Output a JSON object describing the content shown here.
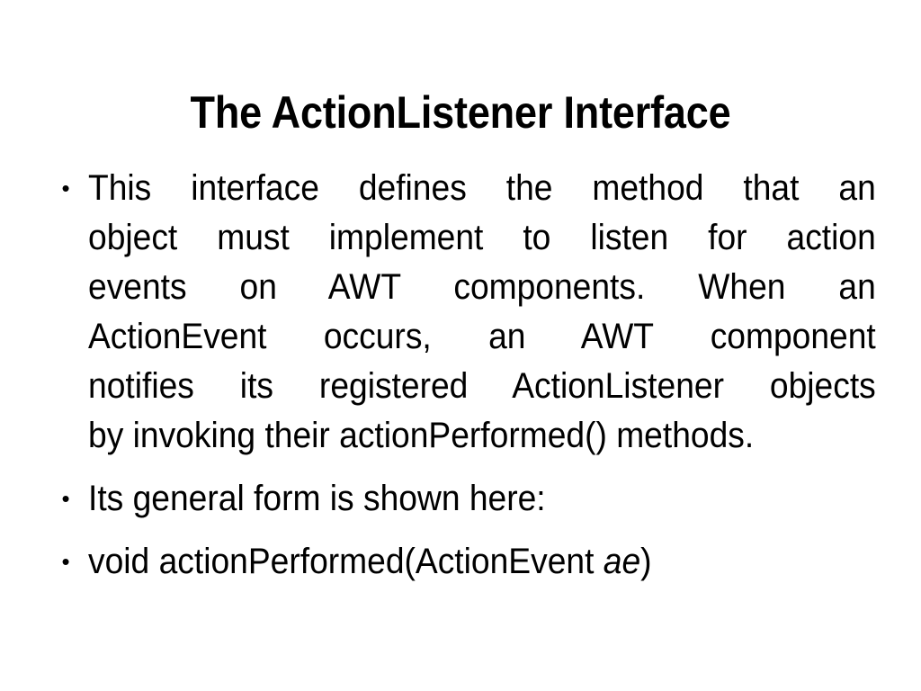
{
  "slide": {
    "background_color": "#ffffff",
    "text_color": "#000000",
    "title": "The ActionListener Interface",
    "bullets": [
      {
        "marker": "bullet-dot",
        "justified": true,
        "text": "This interface defines the method that an object must implement to listen for action events on AWT components. When an ActionEvent occurs, an AWT component notifies its registered ActionListener objects by invoking their actionPerformed() methods.",
        "lines": [
          "This interface defines the method that an",
          "object must implement to listen for action",
          "events on AWT components. When an",
          "ActionEvent occurs, an AWT component",
          "notifies its registered ActionListener objects",
          "by invoking their actionPerformed() methods."
        ]
      },
      {
        "marker": "bullet-dot",
        "justified": false,
        "text": "Its general form is shown here:",
        "lines": [
          "Its general form is shown here:"
        ]
      },
      {
        "marker": "bullet-dot",
        "justified": false,
        "text": "void actionPerformed(ActionEvent ae)",
        "signature_prefix": "void actionPerformed(ActionEvent ",
        "signature_param": "ae",
        "signature_suffix": ")",
        "lines": [
          "void actionPerformed(ActionEvent ae)"
        ]
      }
    ],
    "bullet_glyph": "•"
  }
}
